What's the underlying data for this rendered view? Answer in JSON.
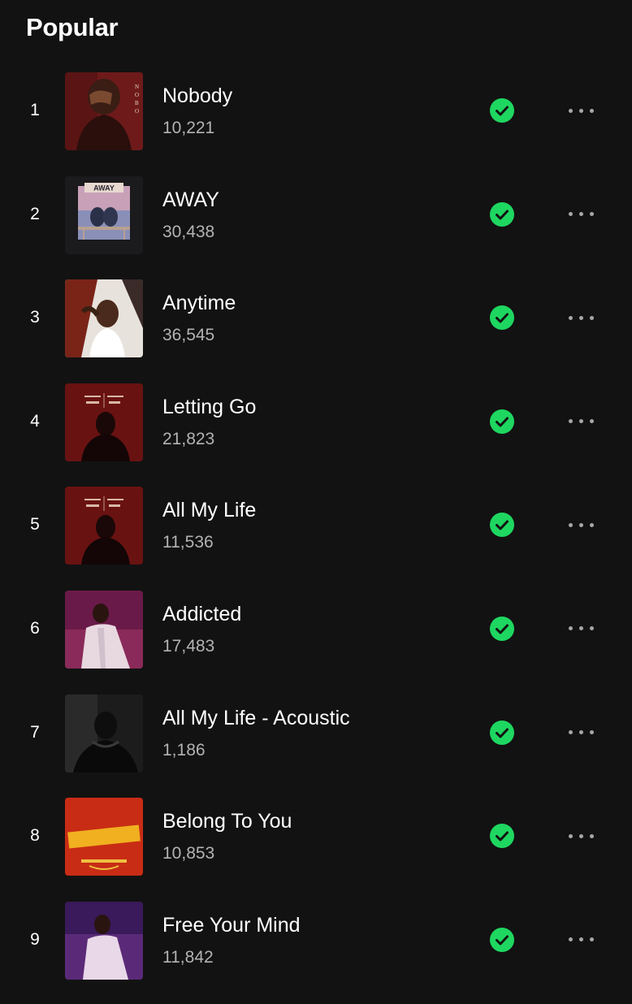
{
  "section": {
    "title": "Popular"
  },
  "colors": {
    "accent": "#1ed760",
    "background": "#121212",
    "secondary_text": "#b3b3b3"
  },
  "tracks": [
    {
      "rank": "1",
      "title": "Nobody",
      "plays": "10,221",
      "downloaded": true,
      "cover_icon": "cover-nobody"
    },
    {
      "rank": "2",
      "title": "AWAY",
      "plays": "30,438",
      "downloaded": true,
      "cover_icon": "cover-away"
    },
    {
      "rank": "3",
      "title": "Anytime",
      "plays": "36,545",
      "downloaded": true,
      "cover_icon": "cover-anytime"
    },
    {
      "rank": "4",
      "title": "Letting Go",
      "plays": "21,823",
      "downloaded": true,
      "cover_icon": "cover-letting-go"
    },
    {
      "rank": "5",
      "title": "All My Life",
      "plays": "11,536",
      "downloaded": true,
      "cover_icon": "cover-all-my-life"
    },
    {
      "rank": "6",
      "title": "Addicted",
      "plays": "17,483",
      "downloaded": true,
      "cover_icon": "cover-addicted"
    },
    {
      "rank": "7",
      "title": "All My Life - Acoustic",
      "plays": "1,186",
      "downloaded": true,
      "cover_icon": "cover-acoustic"
    },
    {
      "rank": "8",
      "title": "Belong To You",
      "plays": "10,853",
      "downloaded": true,
      "cover_icon": "cover-belong-to-you"
    },
    {
      "rank": "9",
      "title": "Free Your Mind",
      "plays": "11,842",
      "downloaded": true,
      "cover_icon": "cover-free-your-mind"
    }
  ]
}
